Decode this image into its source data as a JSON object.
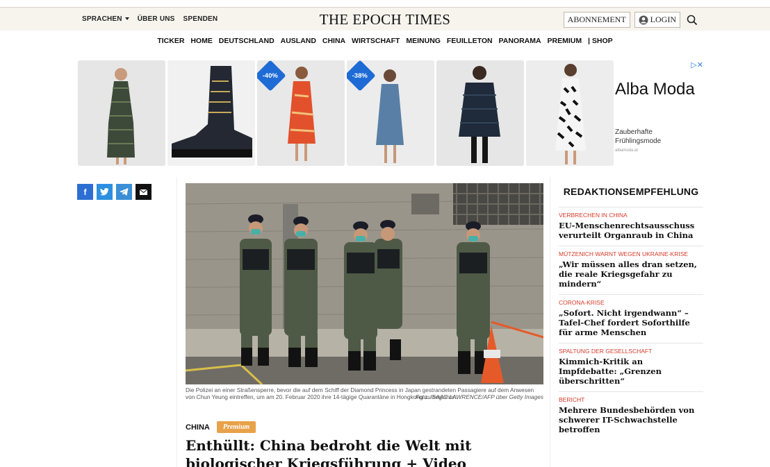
{
  "topbar": {
    "languages_label": "SPRACHEN",
    "about_label": "ÜBER UNS",
    "donate_label": "SPENDEN",
    "logo": "THE EPOCH TIMES",
    "subscription_label": "ABONNEMENT",
    "login_label": "LOGIN"
  },
  "nav": {
    "items": [
      "TICKER",
      "HOME",
      "DEUTSCHLAND",
      "AUSLAND",
      "CHINA",
      "WIRTSCHAFT",
      "MEINUNG",
      "FEUILLETON",
      "PANORAMA",
      "PREMIUM",
      "| SHOP"
    ]
  },
  "ad": {
    "brand": "Alba Moda",
    "tagline": "Zauberhafte Frühlingsmode",
    "url": "albamoda.at",
    "badges": [
      "-40%",
      "-38%"
    ]
  },
  "social": {
    "facebook": "f",
    "twitter": "t",
    "telegram": "tg",
    "email": "mail"
  },
  "article": {
    "caption": "Die Polizei an einer Straßensperre, bevor die auf dem Schiff der Diamond Princess in Japan gestrandeten Passagiere auf dem Anwesen von Chun Yeung eintreffen, um am 20. Februar 2020 ihre 14-tägige Quarantäne in Hongkong zu beginnen.",
    "credit": "Foto: ISAAC LAWRENCE/AFP über Getty Images",
    "category": "CHINA",
    "premium": "Premium",
    "headline": "Enthüllt: China bedroht die Welt mit biologischer Kriegsführung + Video"
  },
  "sidebar": {
    "title": "REDAKTIONSEMPFEHLUNG",
    "items": [
      {
        "kicker": "VERBRECHEN IN CHINA",
        "headline": "EU-Menschenrechtsausschuss verurteilt Organraub in China"
      },
      {
        "kicker": "MÜTZENICH WARNT WEGEN UKRAINE-KRISE",
        "headline": "„Wir müssen alles dran setzen, die reale Kriegsgefahr zu mindern“"
      },
      {
        "kicker": "CORONA-KRISE",
        "headline": "„Sofort. Nicht irgendwann“ – Tafel-Chef fordert Soforthilfe für arme Menschen"
      },
      {
        "kicker": "SPALTUNG DER GESELLSCHAFT",
        "headline": "Kimmich-Kritik an Impfdebatte: „Grenzen überschritten“"
      },
      {
        "kicker": "BERICHT",
        "headline": "Mehrere Bundesbehörden von schwerer IT-Schwachstelle betroffen"
      }
    ]
  },
  "colors": {
    "accent_red": "#d63a2a",
    "topbar_bg": "#f7f4ee",
    "premium": "#e8a24a",
    "ad_badge": "#1e6bd6"
  }
}
